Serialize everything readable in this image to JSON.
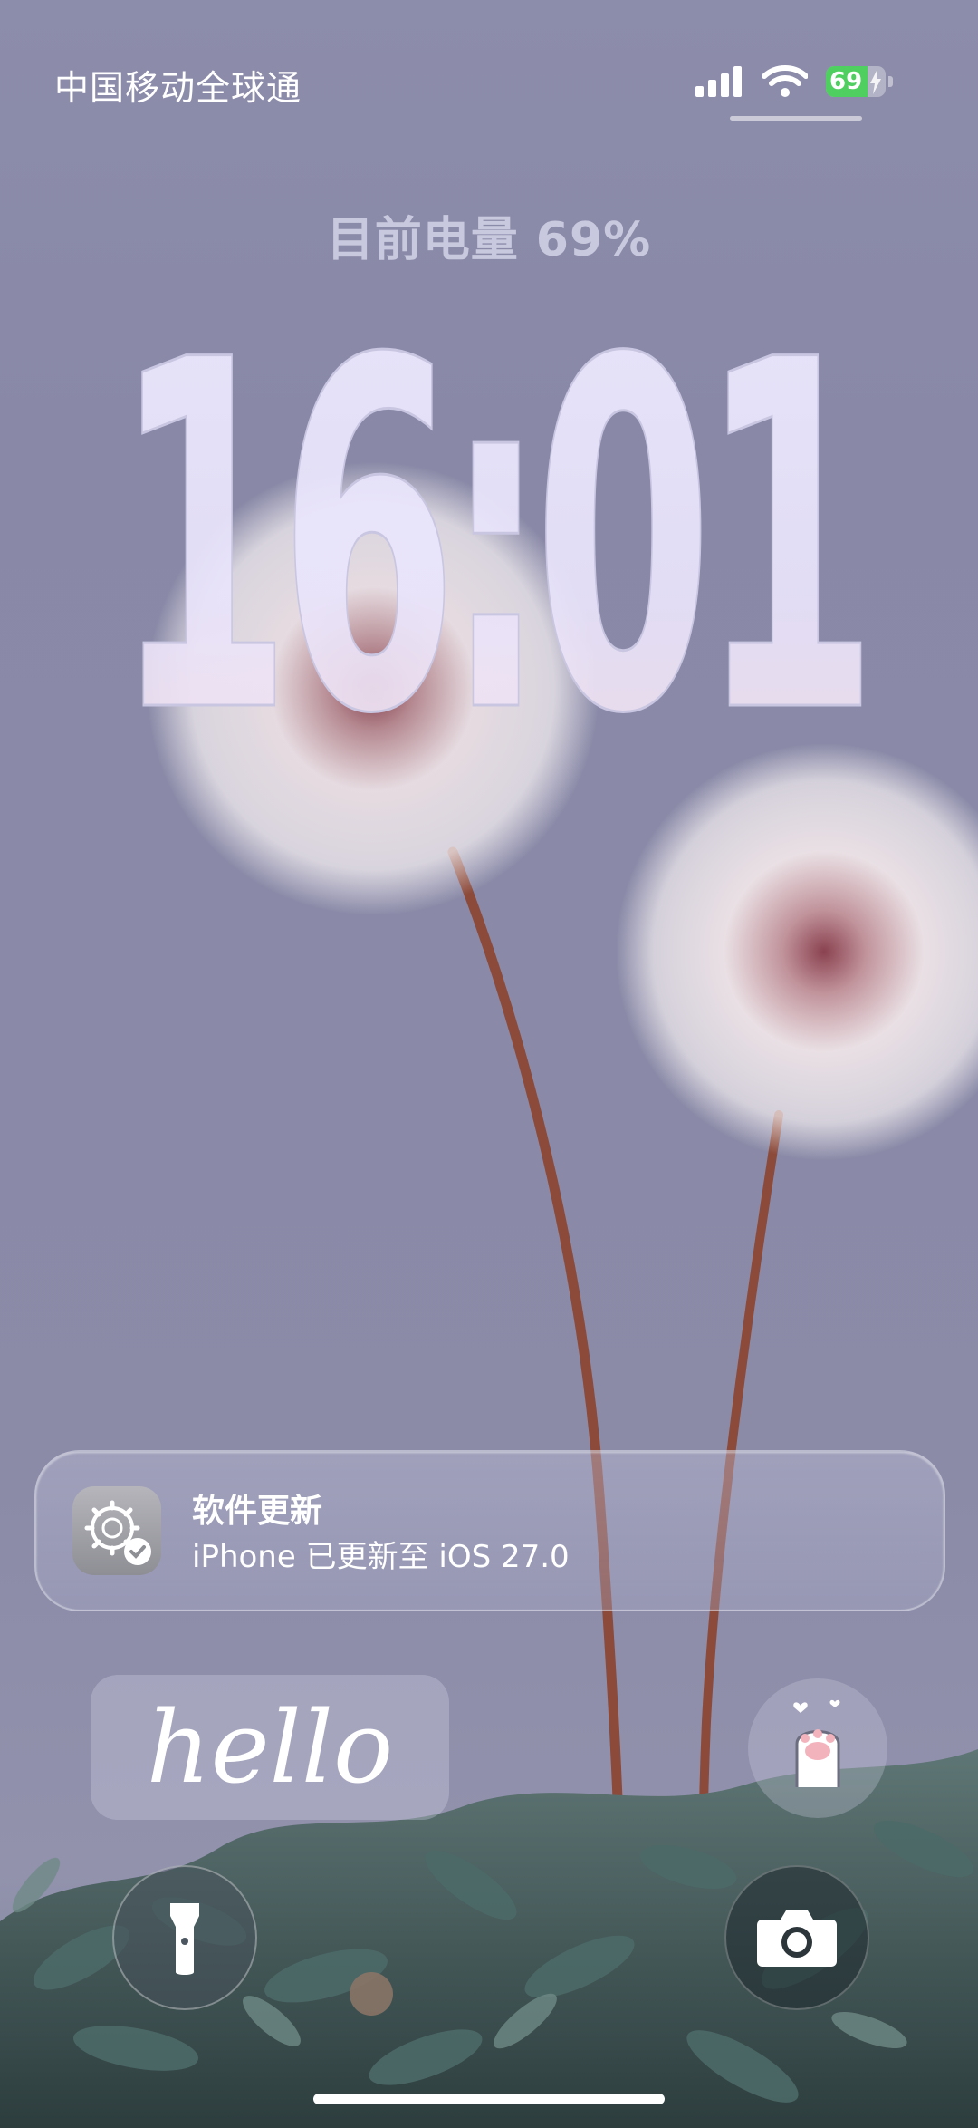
{
  "status_bar": {
    "carrier": "中国移动全球通",
    "battery_percent": 69,
    "battery_text": "69",
    "icons": [
      "cellular-signal-icon",
      "wifi-icon",
      "battery-charging-icon"
    ]
  },
  "lock_screen": {
    "battery_message": "目前电量 69%",
    "time": "16:01"
  },
  "notification": {
    "app_icon": "software-update-gear-icon",
    "title": "软件更新",
    "body": "iPhone 已更新至 iOS 27.0"
  },
  "widgets": {
    "hello_text": "hello",
    "paw_icon": "cat-paw-icon"
  },
  "quick_actions": {
    "flashlight_icon": "flashlight-icon",
    "camera_icon": "camera-icon"
  },
  "colors": {
    "wallpaper": "#8a8aa8",
    "battery_green": "#4fcf5f",
    "clock_tint": "#e8e6fb"
  }
}
